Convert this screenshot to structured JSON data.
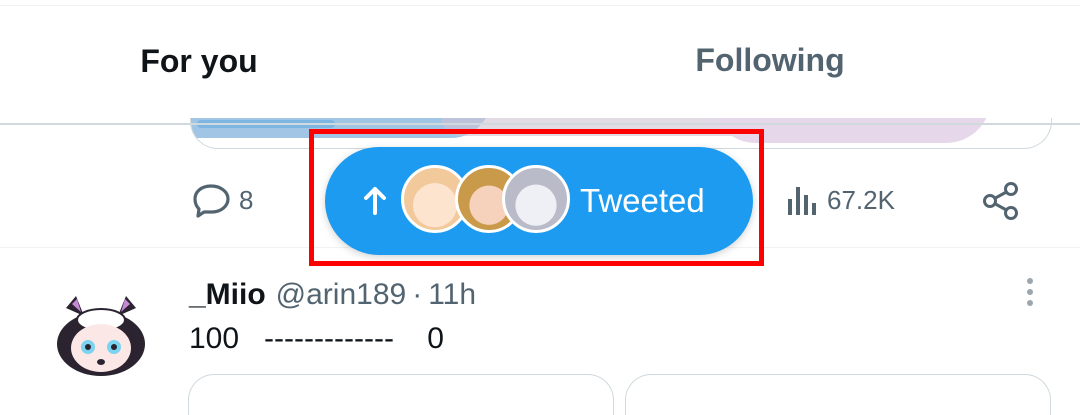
{
  "tabs": [
    {
      "label": "For you",
      "active": true
    },
    {
      "label": "Following",
      "active": false
    }
  ],
  "tweet_actions": {
    "replies": "8",
    "views": "67.2K"
  },
  "new_tweets_pill": {
    "label": "Tweeted",
    "icon": "arrow-up-icon",
    "avatars": [
      "anime-avatar-blonde",
      "anime-avatar-blonde-2",
      "anime-avatar-silver"
    ],
    "background": "#1d9bf0"
  },
  "tweet": {
    "display_name": "_Miio",
    "handle": "@arin189",
    "separator": "·",
    "time": "11h",
    "text": "100   -------------    0"
  },
  "colors": {
    "accent": "#1d9bf0",
    "text_primary": "#0f1419",
    "text_secondary": "#536471",
    "highlight": "#ff0000"
  }
}
